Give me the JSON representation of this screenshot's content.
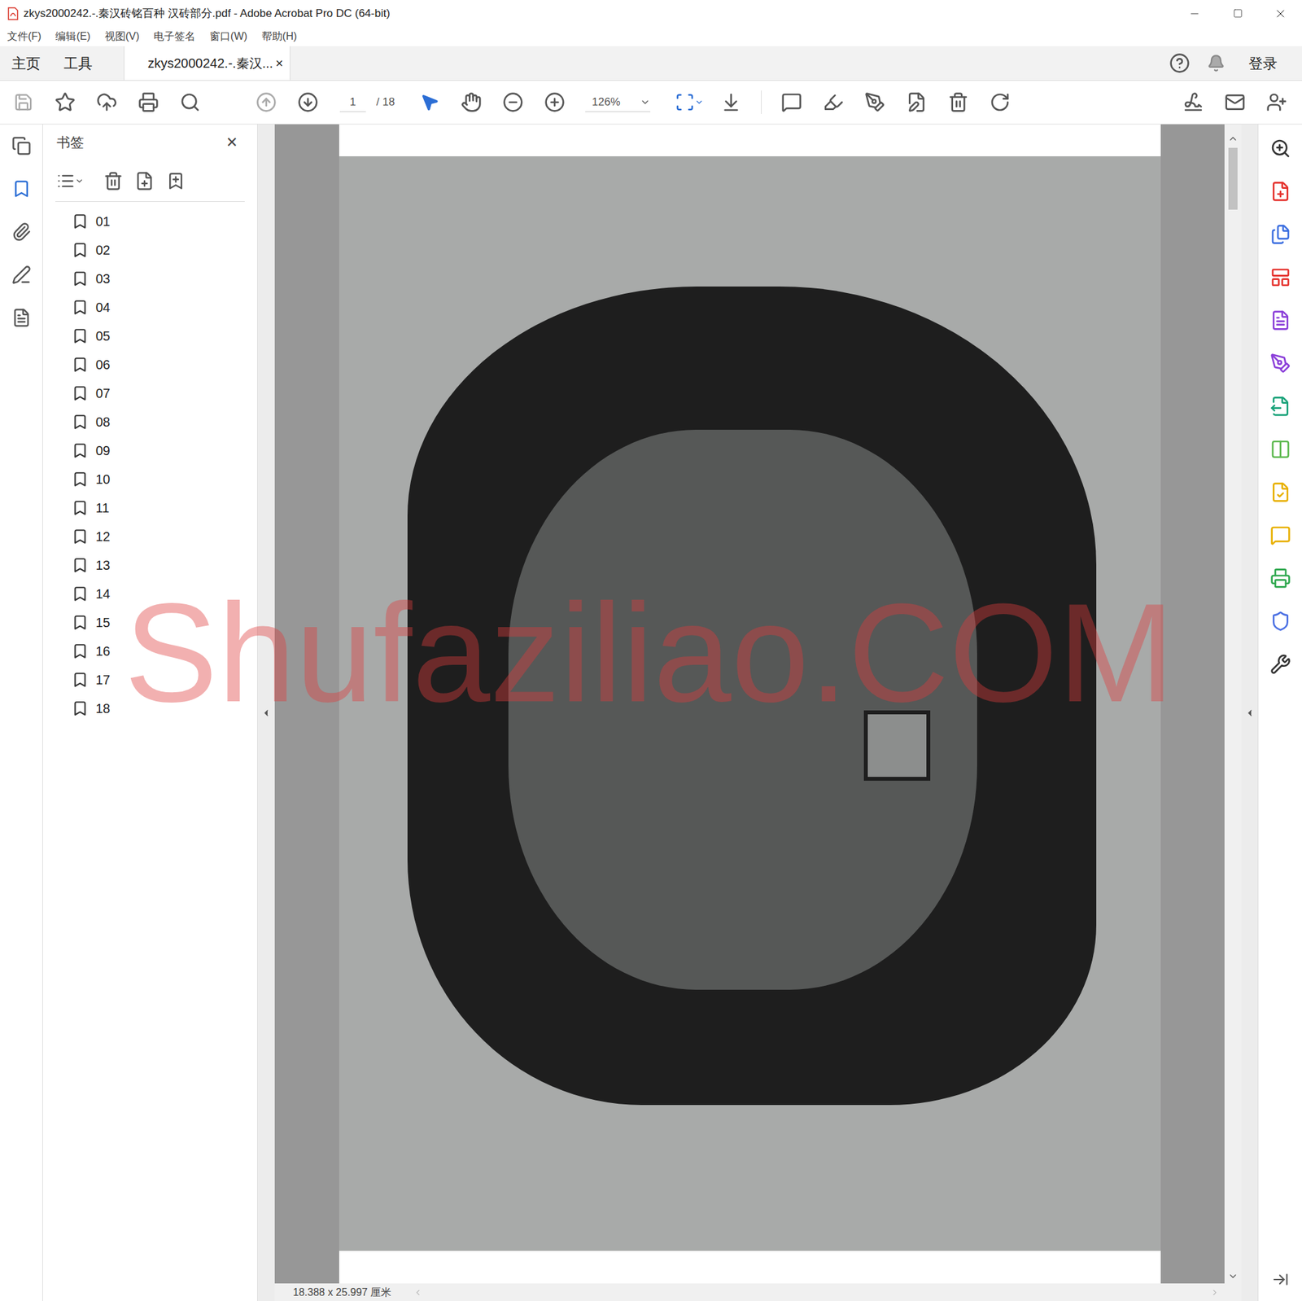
{
  "window": {
    "title": "zkys2000242.-.秦汉砖铭百种 汉砖部分.pdf - Adobe Acrobat Pro DC (64-bit)"
  },
  "menu": [
    "文件(F)",
    "编辑(E)",
    "视图(V)",
    "电子签名",
    "窗口(W)",
    "帮助(H)"
  ],
  "tabs": [
    {
      "label": "主页",
      "selected": false
    },
    {
      "label": "工具",
      "selected": false
    },
    {
      "label": "zkys2000242.-.秦汉...",
      "selected": true,
      "close": "×"
    }
  ],
  "account": {
    "login": "登录"
  },
  "toolbar": {
    "page": "1",
    "page_count": "/ 18",
    "zoom": "126%",
    "select_tool_active": true,
    "hand_tool_active": false
  },
  "left_strip": [
    {
      "selected": false
    },
    {
      "selected": true
    },
    {
      "selected": false
    },
    {
      "selected": false
    },
    {
      "selected": false
    }
  ],
  "bookmarks": {
    "title": "书签",
    "close": "✕",
    "items": [
      {
        "label": "01",
        "selected": false
      },
      {
        "label": "02",
        "selected": false
      },
      {
        "label": "03",
        "selected": false
      },
      {
        "label": "04",
        "selected": false
      },
      {
        "label": "05",
        "selected": false
      },
      {
        "label": "06",
        "selected": false
      },
      {
        "label": "07",
        "selected": false
      },
      {
        "label": "08",
        "selected": false
      },
      {
        "label": "09",
        "selected": false
      },
      {
        "label": "10",
        "selected": false
      },
      {
        "label": "11",
        "selected": false
      },
      {
        "label": "12",
        "selected": false
      },
      {
        "label": "13",
        "selected": false
      },
      {
        "label": "14",
        "selected": false
      },
      {
        "label": "15",
        "selected": false
      },
      {
        "label": "16",
        "selected": false
      },
      {
        "label": "17",
        "selected": false
      },
      {
        "label": "18",
        "selected": false
      }
    ]
  },
  "document": {
    "watermark": "Shufaziliao.COM"
  },
  "status_bar": {
    "page_size": "18.388 x 25.997 厘米"
  }
}
